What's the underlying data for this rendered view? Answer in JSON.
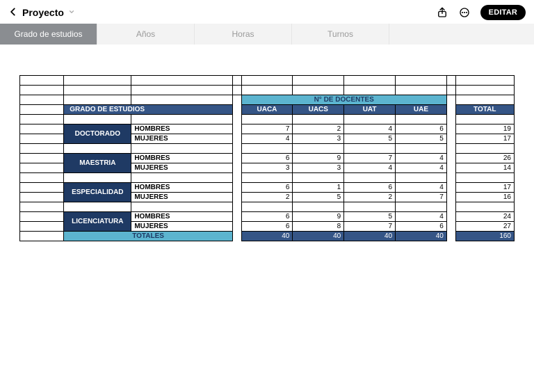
{
  "header": {
    "title": "Proyecto",
    "edit_label": "EDITAR"
  },
  "tabs": [
    "Grado de estudios",
    "Años",
    "Horas",
    "Turnos"
  ],
  "table": {
    "header_grado": "GRADO DE ESTUDIOS",
    "header_ndoc": "N° DE DOCENTES",
    "cols": [
      "UACA",
      "UACS",
      "UAT",
      "UAE"
    ],
    "total_col": "TOTAL",
    "genders": {
      "h": "HOMBRES",
      "m": "MUJERES"
    },
    "groups": [
      {
        "name": "DOCTORADO",
        "h": [
          7,
          2,
          4,
          6
        ],
        "ht": 19,
        "m": [
          4,
          3,
          5,
          5
        ],
        "mt": 17
      },
      {
        "name": "MAESTRIA",
        "h": [
          6,
          9,
          7,
          4
        ],
        "ht": 26,
        "m": [
          3,
          3,
          4,
          4
        ],
        "mt": 14
      },
      {
        "name": "ESPECIALIDAD",
        "h": [
          6,
          1,
          6,
          4
        ],
        "ht": 17,
        "m": [
          2,
          5,
          2,
          7
        ],
        "mt": 16
      },
      {
        "name": "LICENCIATURA",
        "h": [
          6,
          9,
          5,
          4
        ],
        "ht": 24,
        "m": [
          6,
          8,
          7,
          6
        ],
        "mt": 27
      }
    ],
    "totals_label": "TOTALES",
    "totals": {
      "cols": [
        40,
        40,
        40,
        40
      ],
      "grand": 160
    }
  },
  "colors": {
    "dark": "#1f3a64",
    "mid": "#355586",
    "aqua": "#5cb4cf",
    "tabActive": "#8a8d91"
  }
}
